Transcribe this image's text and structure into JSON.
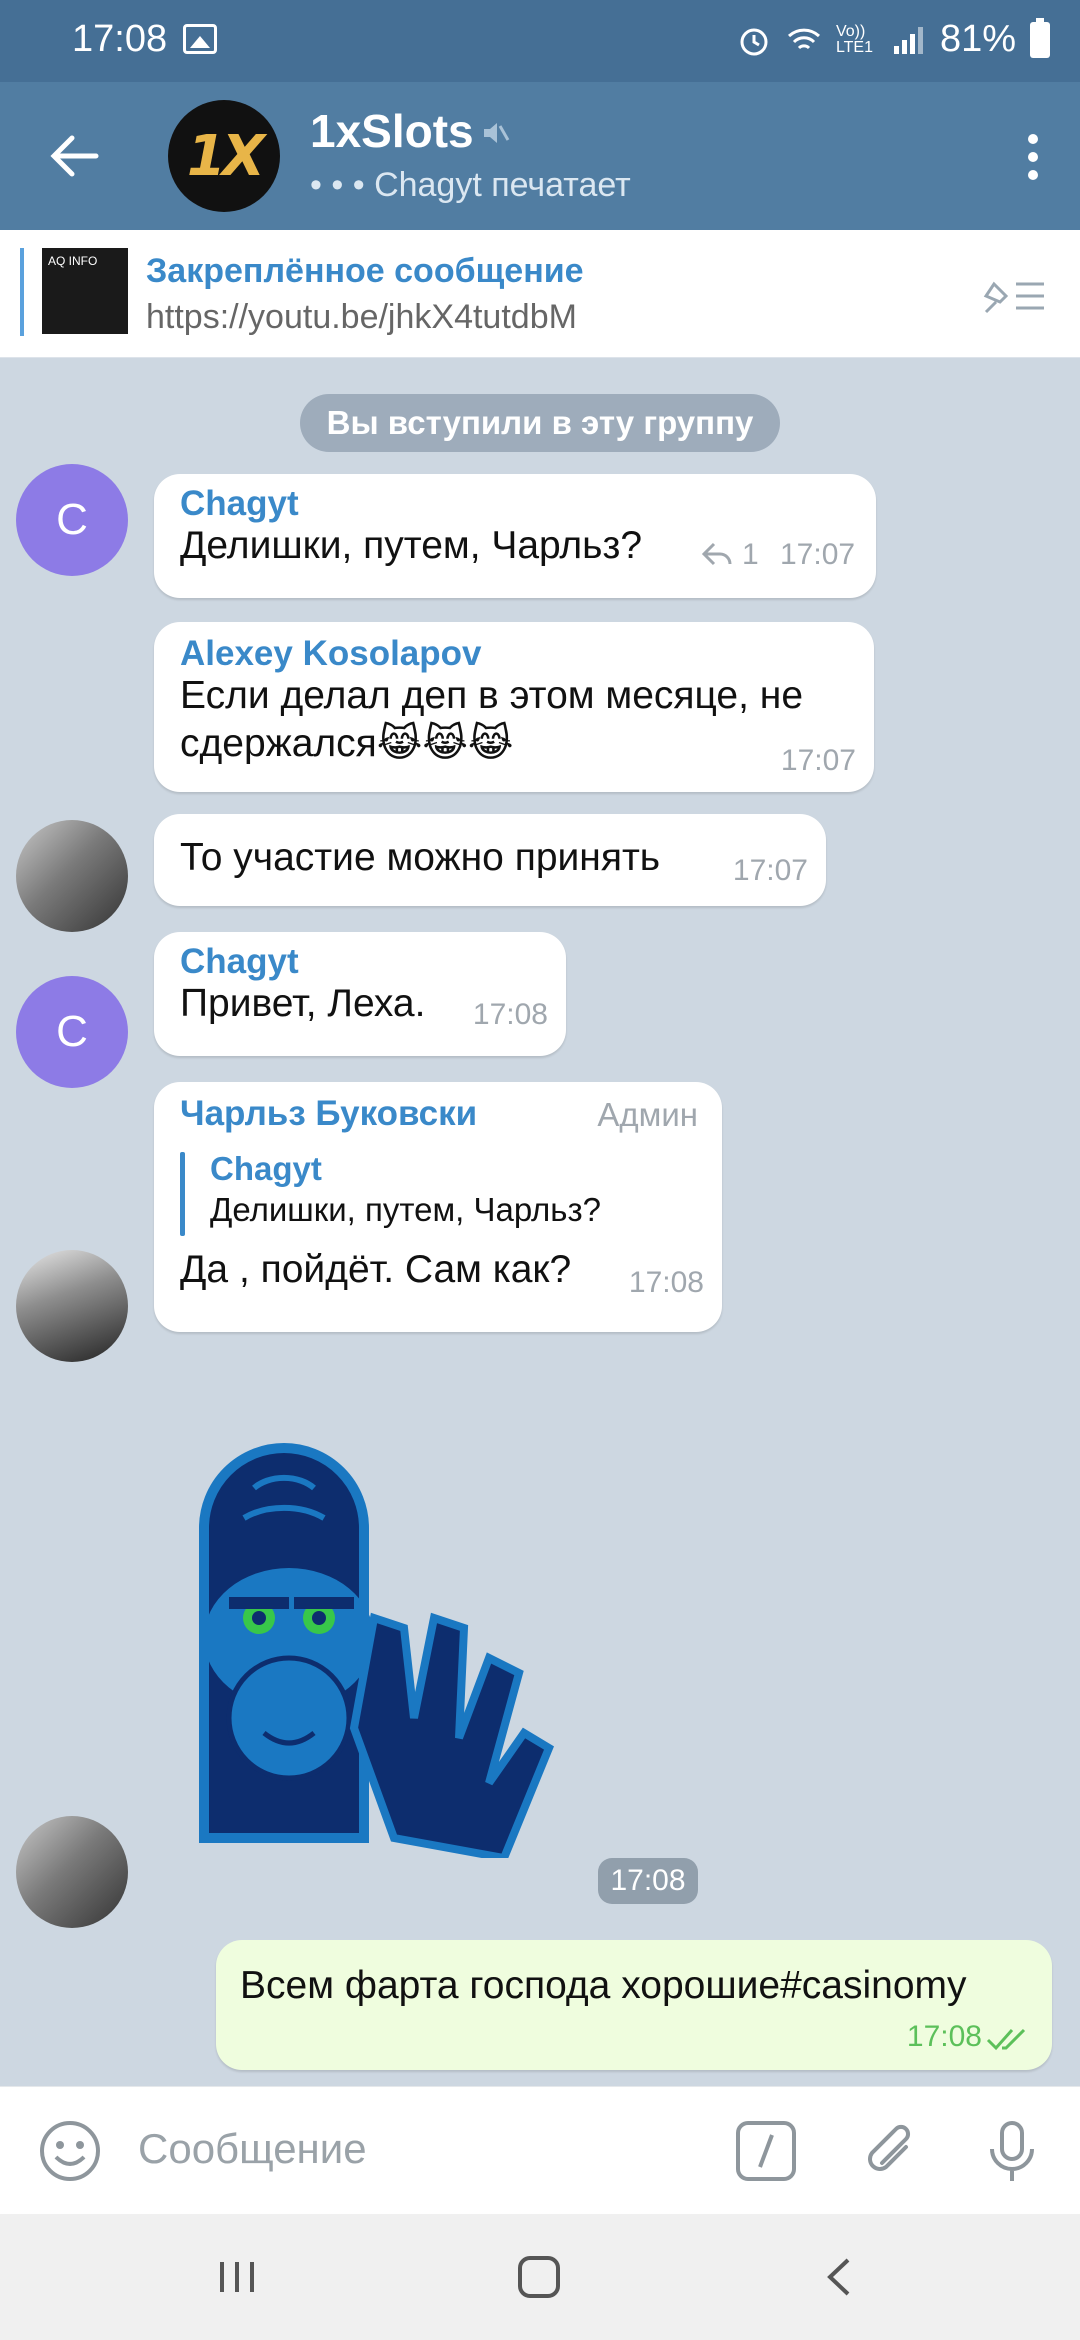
{
  "status": {
    "time": "17:08",
    "network": "Vo)) LTE1",
    "battery": "81%"
  },
  "header": {
    "title": "1xSlots",
    "avatar_text": "1X",
    "subtitle": "Chagyt печатает"
  },
  "pinned": {
    "title": "Закреплённое сообщение",
    "text": "https://youtu.be/jhkX4tutdbM",
    "thumb_text": "AQ INFO"
  },
  "service_message": "Вы вступили в эту группу",
  "messages": [
    {
      "sender": "Chagyt",
      "text": "Делишки, путем, Чарльз?",
      "time": "17:07",
      "replies": "1",
      "avatar_letter": "C"
    },
    {
      "sender": "Alexey Kosolapov",
      "text": "Если делал деп в этом месяце, не сдержался😹😹😹",
      "time": "17:07"
    },
    {
      "text": "То участие можно принять",
      "time": "17:07"
    },
    {
      "sender": "Chagyt",
      "text": "Привет, Леха.",
      "time": "17:08",
      "avatar_letter": "C"
    },
    {
      "sender": "Чарльз Буковски",
      "badge": "Админ",
      "reply_sender": "Chagyt",
      "reply_text": "Делишки, путем, Чарльз?",
      "text": "Да , пойдёт. Сам как?",
      "time": "17:08"
    }
  ],
  "sticker": {
    "time": "17:08"
  },
  "outgoing": {
    "text": "Всем фарта господа хорошие#casinomy",
    "time": "17:08"
  },
  "input": {
    "placeholder": "Сообщение"
  }
}
